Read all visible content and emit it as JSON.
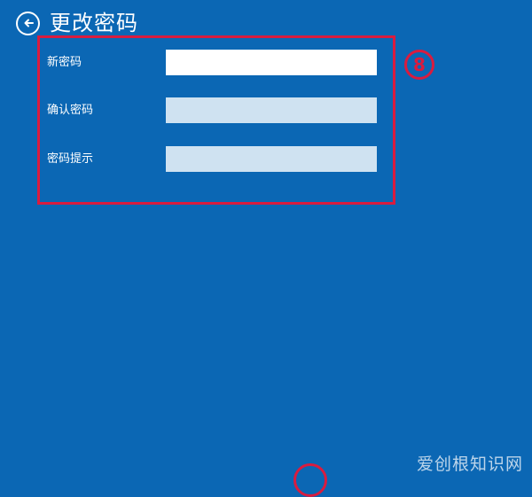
{
  "header": {
    "title": "更改密码",
    "back_icon": "arrow-left-circle-icon"
  },
  "form": {
    "fields": [
      {
        "label": "新密码",
        "value": "",
        "state": "active"
      },
      {
        "label": "确认密码",
        "value": "",
        "state": "inactive"
      },
      {
        "label": "密码提示",
        "value": "",
        "state": "inactive"
      }
    ]
  },
  "annotations": {
    "step_number": "8"
  },
  "watermark": {
    "text": "爱创根知识网"
  },
  "colors": {
    "background": "#0b67b4",
    "annotation_red": "#d91c3f",
    "active_input": "#ffffff",
    "inactive_input": "#cfe2f1"
  }
}
